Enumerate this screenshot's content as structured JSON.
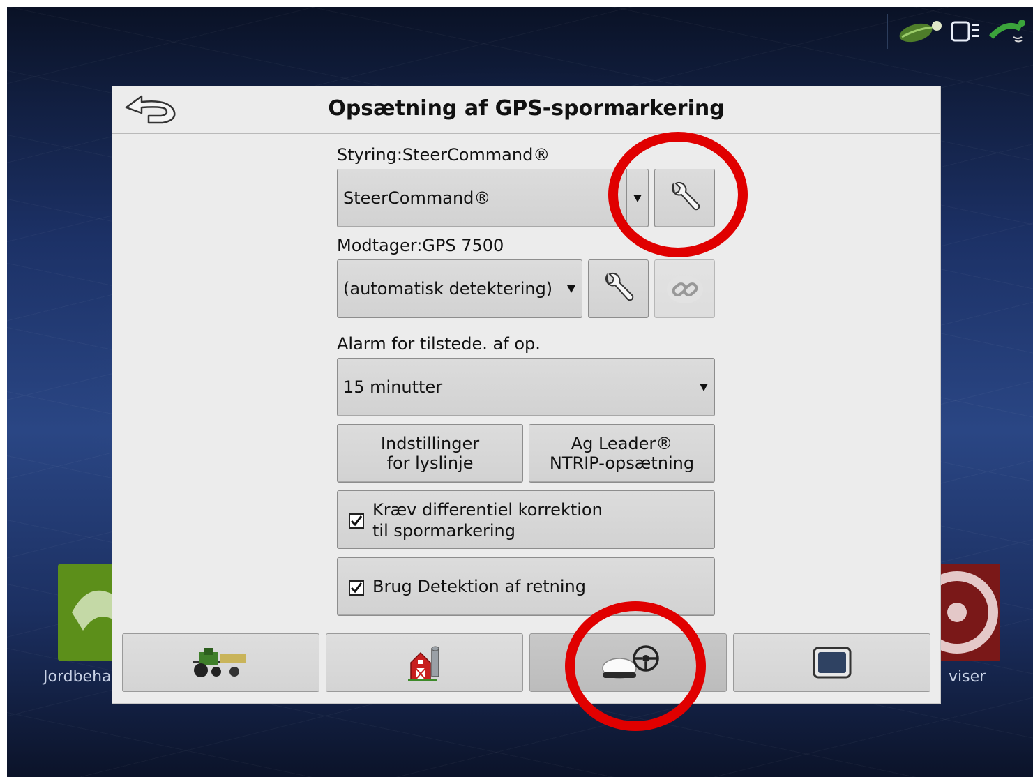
{
  "dialog": {
    "title": "Opsætning af GPS-spormarkering"
  },
  "steering": {
    "label": "Styring:SteerCommand®",
    "selected": "SteerCommand®"
  },
  "receiver": {
    "label": "Modtager:GPS 7500",
    "selected": "(automatisk detektering)"
  },
  "alarm": {
    "label": "Alarm for tilstede. af op.",
    "selected": "15 minutter"
  },
  "buttons": {
    "lightbar_line1": "Indstillinger",
    "lightbar_line2": "for lyslinje",
    "ntrip_line1": "Ag Leader®",
    "ntrip_line2": "NTRIP-opsætning"
  },
  "checkboxes": {
    "diff_line1": "Kræv differentiel korrektion",
    "diff_line2": "til spormarkering",
    "diff_checked": true,
    "heading": "Brug Detektion af retning",
    "heading_checked": true
  },
  "background": {
    "left_tile_label": "Jordbeha",
    "right_tile_label": "viser"
  },
  "colors": {
    "annotation": "#e00000",
    "left_tile": "#5c8f1a",
    "right_tile": "#7a1818"
  },
  "tabs": [
    "tractor-tab",
    "farm-tab",
    "gps-steering-tab",
    "display-tab"
  ],
  "active_tab": "gps-steering-tab"
}
